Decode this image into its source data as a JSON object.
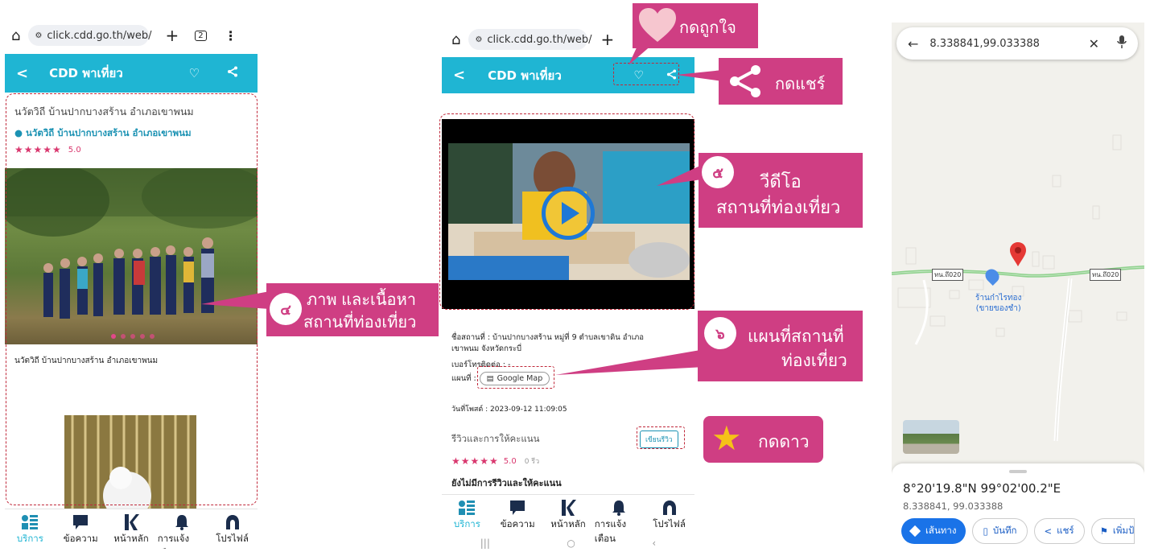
{
  "browser": {
    "url": "click.cdd.go.th/web/",
    "tab_count": "2"
  },
  "app": {
    "title": "CDD พาเที่ยว"
  },
  "screen1": {
    "place_title": "นวัตวิถี บ้านปากบางสร้าน อำเภอเขาพนม",
    "place_link": "นวัตวิถี บ้านปากบางสร้าน อำเภอเขาพนม",
    "rating_stars": "★★★★★",
    "rating_value": "5.0",
    "caption": "นวัตวิถี บ้านปากบางสร้าน อำเภอเขาพนม"
  },
  "screen2": {
    "place_name": "ชื่อสถานที่ : บ้านปากบางสร้าน หมู่ที่ 9 ตำบลเขาดิน อำเภอเขาพนม จังหวัดกระบี่",
    "phone_label": "เบอร์โทรติดต่อ : -",
    "map_label": "แผนที่ :",
    "map_button": "Google Map",
    "updated": "วันที่โพสต์ : 2023-09-12 11:09:05",
    "reviews_title": "รีวิวและการให้คะแนน",
    "write_review": "เขียนรีวิว",
    "rating_stars": "★★★★★",
    "rating_value": "5.0",
    "review_count": "0 รีว",
    "no_reviews": "ยังไม่มีการรีวิวและให้คะแนน"
  },
  "nav": {
    "items": [
      {
        "label": "บริการ",
        "icon": "services-grid-icon"
      },
      {
        "label": "ข้อความ",
        "icon": "message-icon"
      },
      {
        "label": "หน้าหลัก",
        "icon": "home-k-logo-icon"
      },
      {
        "label": "การแจ้งเตือน",
        "icon": "bell-icon"
      },
      {
        "label": "โปรไฟล์",
        "icon": "profile-icon"
      }
    ]
  },
  "callouts": {
    "like": "กดถูกใจ",
    "share": "กดแชร์",
    "video_num": "๕",
    "video_line1": "วีดีโอ",
    "video_line2": "สถานที่ท่องเที่ยว",
    "content_num": "๔",
    "content_line1": "ภาพ และเนื้อหา",
    "content_line2": "สถานที่ท่องเที่ยว",
    "map_num": "๖",
    "map_line1": "แผนที่สถานที่",
    "map_line2": "ท่องเที่ยว",
    "star": "กดดาว"
  },
  "maps": {
    "search_value": "8.338841,99.033388",
    "road_label_1": "ทน.ถึ020",
    "road_label_2": "ทน.ถึ020",
    "poi_line1": "ร้านก๋าไรทอง",
    "poi_line2": "(ขายของชำ)",
    "dms": "8°20'19.8\"N 99°02'00.2\"E",
    "decimal": "8.338841, 99.033388",
    "btn_directions": "เส้นทาง",
    "btn_save": "บันทึก",
    "btn_share": "แชร์",
    "btn_more": "เพิ่มป้"
  },
  "colors": {
    "header": "#1fb5d3",
    "callout": "#cf3e83",
    "dash": "#c0283a",
    "star": "#d9376e"
  }
}
